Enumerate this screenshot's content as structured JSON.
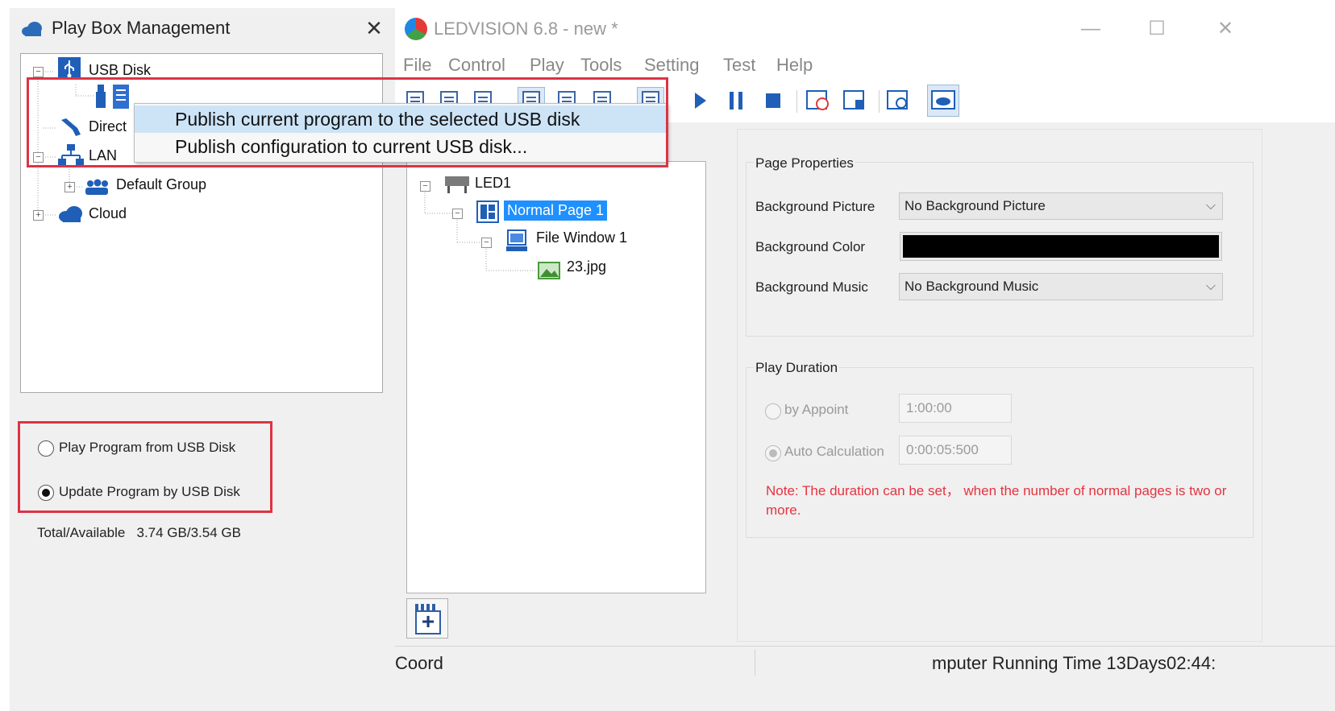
{
  "left_panel": {
    "title": "Play Box Management",
    "close": "✕",
    "tree": {
      "usb_disk": "USB Disk",
      "direct": "Direct",
      "lan": "LAN",
      "default_group": "Default Group",
      "cloud": "Cloud"
    },
    "options": [
      {
        "label": "Play Program from USB Disk",
        "checked": false
      },
      {
        "label": "Update Program by USB Disk",
        "checked": true
      }
    ],
    "total_label": "Total/Available",
    "total_value": "3.74 GB/3.54 GB"
  },
  "context_menu": {
    "items": [
      {
        "label": "Publish current program to the selected USB disk",
        "highlighted": true
      },
      {
        "label": "Publish configuration to current USB disk...",
        "highlighted": false
      }
    ]
  },
  "main_window": {
    "title": "LEDVISION 6.8 - new *",
    "controls": {
      "minimize": "—",
      "maximize": "☐",
      "close": "✕"
    },
    "menu": [
      "File",
      "Control",
      "Play",
      "Tools",
      "Setting",
      "Test",
      "Help"
    ],
    "program_tree": {
      "led": "LED1",
      "page": "Normal Page 1",
      "window": "File Window 1",
      "file": "23.jpg"
    },
    "page_properties": {
      "title": "Page Properties",
      "bg_picture_label": "Background Picture",
      "bg_picture_value": "No Background Picture",
      "bg_color_label": "Background Color",
      "bg_color_value": "#000000",
      "bg_music_label": "Background Music",
      "bg_music_value": "No Background Music"
    },
    "play_duration": {
      "title": "Play Duration",
      "by_appoint_label": "by Appoint",
      "by_appoint_value": "1:00:00",
      "auto_calc_label": "Auto Calculation",
      "auto_calc_value": "0:00:05:500",
      "note": "Note: The duration can be set， when the number of normal pages is two or more."
    },
    "status": {
      "coord": "Coord",
      "running": "mputer Running Time 13Days02:44:"
    }
  },
  "colors": {
    "highlight_outline": "#dd3344",
    "selection": "#1e90ff",
    "menu_hover": "#cde4f7",
    "note_text": "#e53340"
  }
}
